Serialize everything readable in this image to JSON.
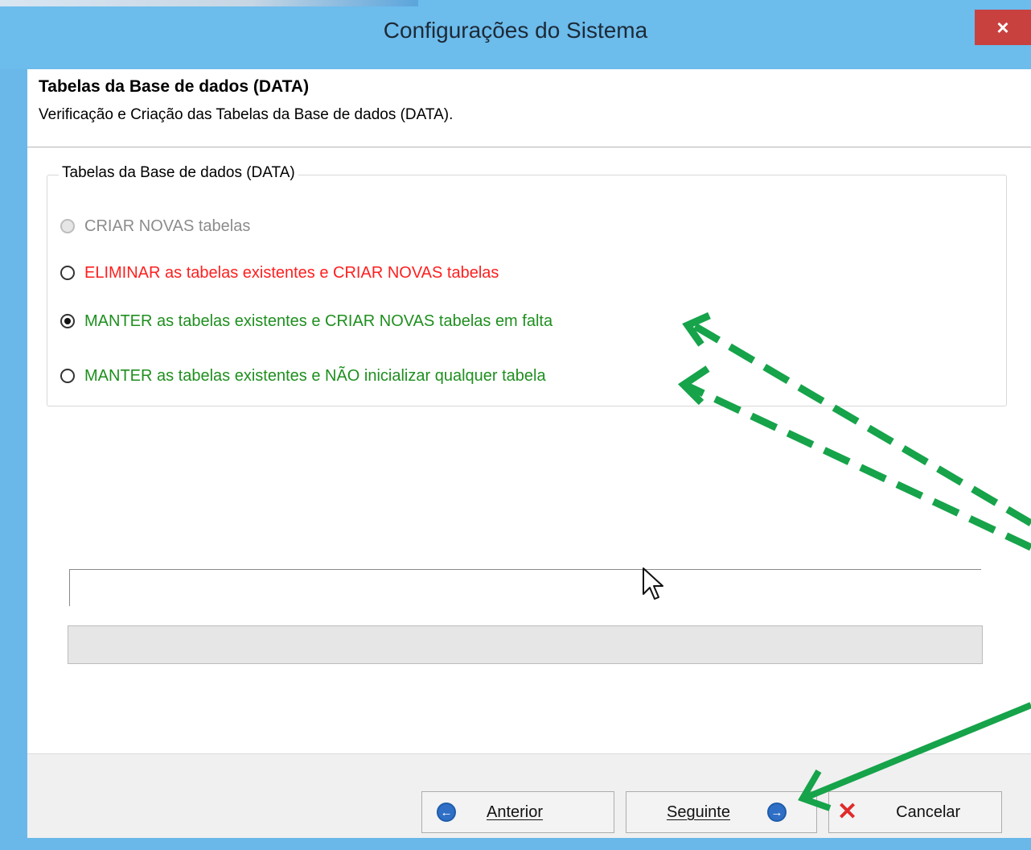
{
  "window": {
    "title": "Configurações do Sistema",
    "close_label": "×"
  },
  "header": {
    "title": "Tabelas da Base de dados (DATA)",
    "subtitle": "Verificação e Criação das Tabelas da Base de dados (DATA)."
  },
  "group": {
    "legend": "Tabelas da Base de dados (DATA)",
    "options": [
      {
        "label": "CRIAR NOVAS tabelas",
        "state": "disabled",
        "color": "#8c8c8c"
      },
      {
        "label": "ELIMINAR as tabelas existentes e CRIAR NOVAS tabelas",
        "state": "unchecked",
        "color": "#ff1f1f"
      },
      {
        "label": "MANTER as tabelas existentes e CRIAR NOVAS tabelas em falta",
        "state": "checked",
        "color": "#1f8f1f"
      },
      {
        "label": "MANTER as tabelas existentes e NÃO inicializar qualquer tabela",
        "state": "unchecked",
        "color": "#1f8f1f"
      }
    ]
  },
  "progress": {
    "value_percent": 0
  },
  "buttons": {
    "back_label": "Anterior",
    "next_label": "Seguinte",
    "cancel_label": "Cancelar"
  },
  "icons": {
    "back": "arrow-left-circle-icon",
    "next": "arrow-right-circle-icon",
    "cancel": "red-x-icon",
    "close": "close-icon"
  },
  "colors": {
    "titlebar": "#6cbcec",
    "close_button": "#c8413f",
    "annotation_arrows": "#16a34a"
  }
}
